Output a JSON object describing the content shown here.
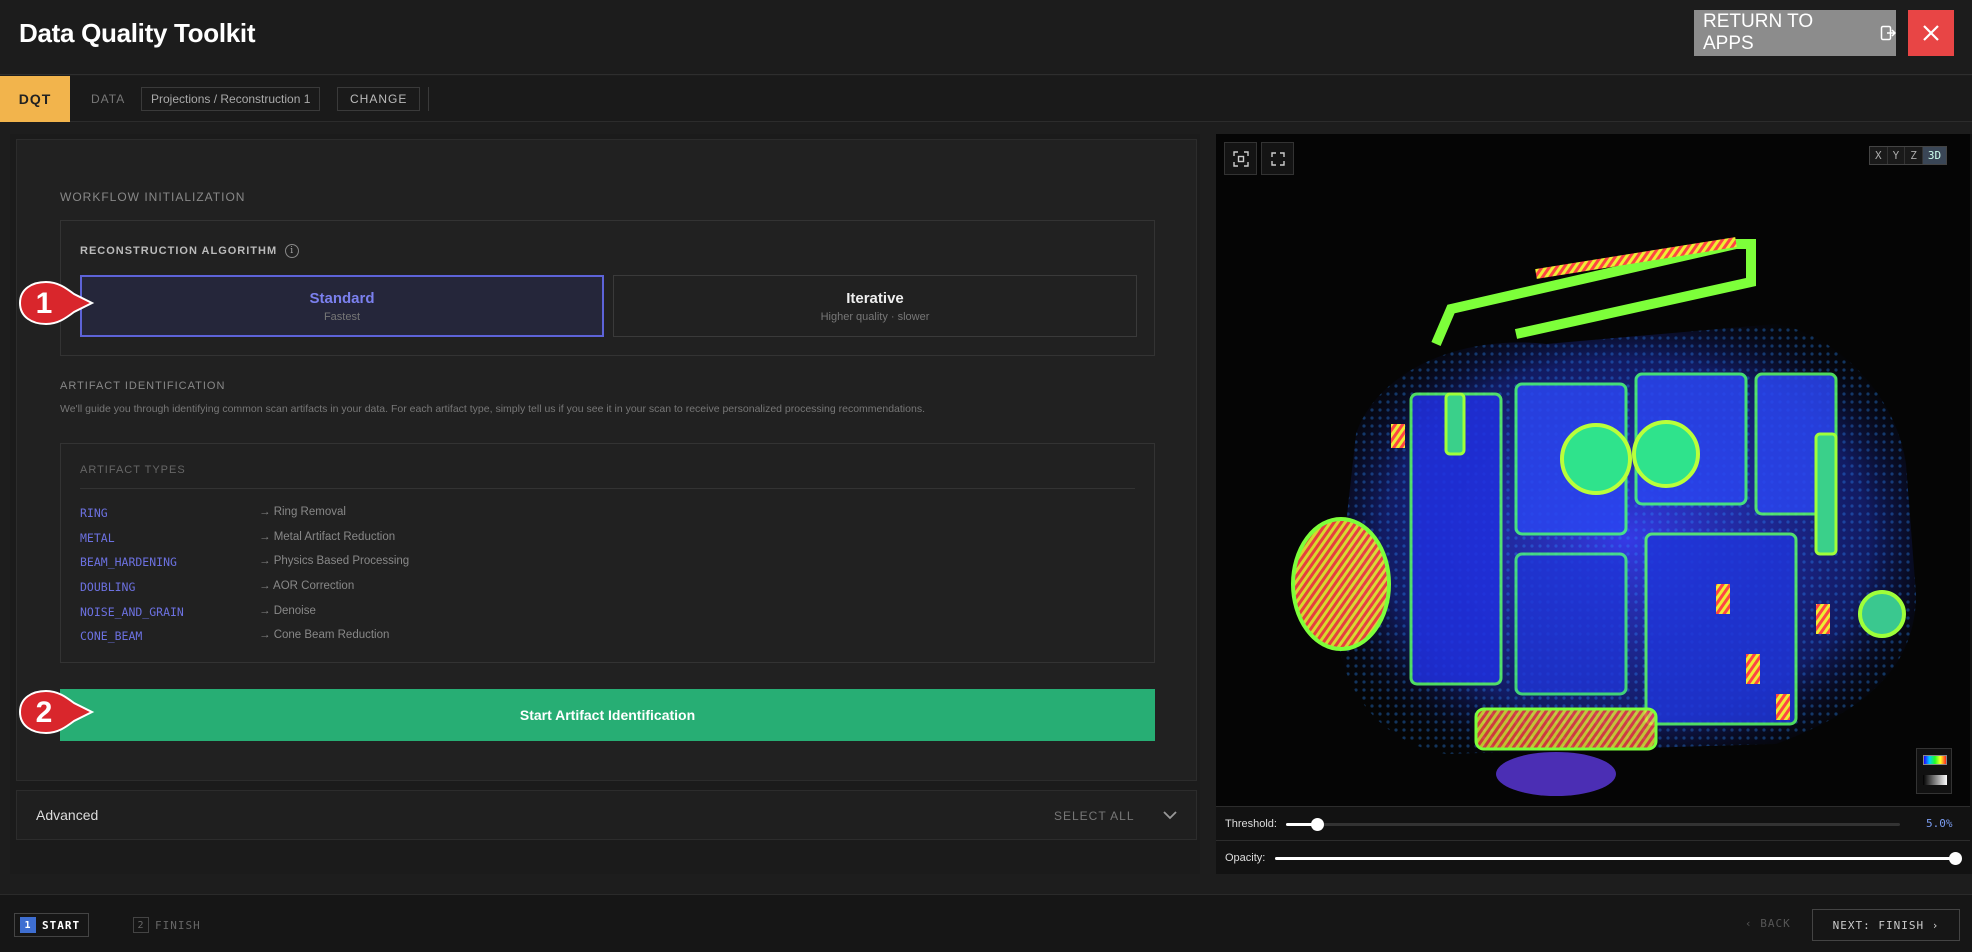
{
  "header": {
    "title": "Data Quality Toolkit",
    "return_label": "RETURN TO APPS"
  },
  "tabs": {
    "dqt": "DQT",
    "data": "DATA",
    "project": "Projections / Reconstruction 1",
    "change": "CHANGE"
  },
  "workflow": {
    "title": "WORKFLOW INITIALIZATION",
    "algorithm_label": "RECONSTRUCTION ALGORITHM",
    "info_icon": "i",
    "options": [
      {
        "title": "Standard",
        "subtitle": "Fastest",
        "selected": true
      },
      {
        "title": "Iterative",
        "subtitle": "Higher quality · slower",
        "selected": false
      }
    ],
    "artifact_title": "ARTIFACT IDENTIFICATION",
    "artifact_desc": "We'll guide you through identifying common scan artifacts in your data. For each artifact type, simply tell us if you see it in your scan to receive personalized processing recommendations.",
    "types_header": "ARTIFACT TYPES",
    "types": [
      {
        "name": "RING",
        "action": "→ Ring Removal"
      },
      {
        "name": "METAL",
        "action": "→ Metal Artifact Reduction"
      },
      {
        "name": "BEAM_HARDENING",
        "action": "→ Physics Based Processing"
      },
      {
        "name": "DOUBLING",
        "action": "→ AOR Correction"
      },
      {
        "name": "NOISE_AND_GRAIN",
        "action": "→ Denoise"
      },
      {
        "name": "CONE_BEAM",
        "action": "→ Cone Beam Reduction"
      }
    ],
    "start_label": "Start Artifact Identification"
  },
  "advanced": {
    "label": "Advanced",
    "select_all": "SELECT ALL"
  },
  "viewer": {
    "axes": [
      "X",
      "Y",
      "Z",
      "3D"
    ],
    "active_axis": "3D",
    "threshold_label": "Threshold:",
    "threshold_value": "5.0%",
    "threshold_fraction": 0.05,
    "opacity_label": "Opacity:",
    "opacity_fraction": 1.0
  },
  "footer": {
    "step1_num": "1",
    "step1_label": "START",
    "step2_num": "2",
    "step2_label": "FINISH",
    "back_label": "‹ BACK",
    "next_label": "NEXT: FINISH ›"
  },
  "callouts": [
    "1",
    "2"
  ],
  "colors": {
    "accent_tab": "#f2b44c",
    "selected_option": "#5d63d8",
    "start_button": "#27ae74",
    "close_button": "#e84545",
    "callout": "#d9262c"
  }
}
